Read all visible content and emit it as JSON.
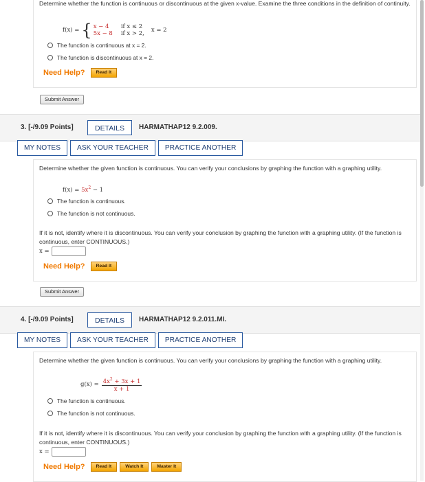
{
  "q2": {
    "intro": "Determine whether the function is continuous or discontinuous at the given x-value. Examine the three conditions in the definition of continuity.",
    "fx": "f(x) =",
    "case1_expr": "x − 4",
    "case1_cond": "if x ≤ 2",
    "case2_expr": "5x − 8",
    "case2_cond": "if x > 2",
    "xval": "x = 2",
    "options": [
      "The function is continuous at x = 2.",
      "The function is discontinuous at x = 2."
    ],
    "need_help": "Need Help?",
    "read_it": "Read It",
    "submit": "Submit Answer"
  },
  "q3": {
    "number": "3. [-/9.09 Points]",
    "details": "DETAILS",
    "code": "HARMATHAP12 9.2.009.",
    "tabs": [
      "MY NOTES",
      "ASK YOUR TEACHER",
      "PRACTICE ANOTHER"
    ],
    "intro": "Determine whether the given function is continuous. You can verify your conclusions by graphing the function with a graphing utility.",
    "func_lhs": "f(x) =",
    "func_rhs_a": "5x",
    "func_rhs_exp": "2",
    "func_rhs_b": " − 1",
    "options": [
      "The function is continuous.",
      "The function is not continuous."
    ],
    "followup": "If it is not, identify where it is discontinuous. You can verify your conclusion by graphing the function with a graphing utility. (If the function is continuous, enter CONTINUOUS.)",
    "x_label": "x =",
    "need_help": "Need Help?",
    "read_it": "Read It",
    "submit": "Submit Answer"
  },
  "q4": {
    "number": "4. [-/9.09 Points]",
    "details": "DETAILS",
    "code": "HARMATHAP12 9.2.011.MI.",
    "tabs": [
      "MY NOTES",
      "ASK YOUR TEACHER",
      "PRACTICE ANOTHER"
    ],
    "intro": "Determine whether the given function is continuous. You can verify your conclusions by graphing the function with a graphing utility.",
    "func_lhs": "g(x) =",
    "num_a": "4x",
    "num_exp": "2",
    "num_b": " + 3x + 1",
    "den": "x + 1",
    "options": [
      "The function is continuous.",
      "The function is not continuous."
    ],
    "followup": "If it is not, identify where it is discontinuous. You can verify your conclusion by graphing the function with a graphing utility. (If the function is continuous, enter CONTINUOUS.)",
    "x_label": "x =",
    "need_help": "Need Help?",
    "read_it": "Read It",
    "watch_it": "Watch It",
    "master_it": "Master It"
  }
}
